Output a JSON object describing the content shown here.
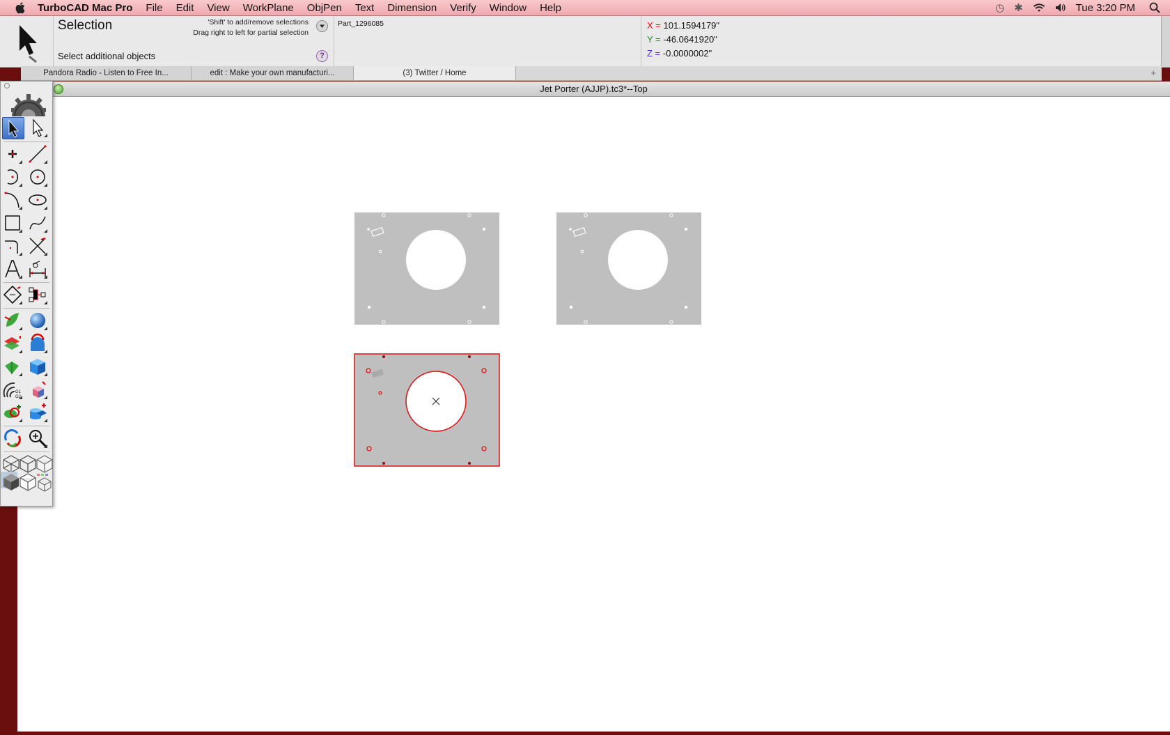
{
  "menubar": {
    "app_name": "TurboCAD Mac Pro",
    "items": [
      "File",
      "Edit",
      "View",
      "WorkPlane",
      "ObjPen",
      "Text",
      "Dimension",
      "Verify",
      "Window",
      "Help"
    ],
    "status_icons": [
      "time-machine-icon",
      "bluetooth-icon",
      "wifi-icon",
      "volume-icon"
    ],
    "clock": "Tue 3:20 PM"
  },
  "infobar": {
    "tool_name": "Selection",
    "hint_line1": "'Shift' to add/remove selections",
    "hint_line2": "Drag right to left for partial selection",
    "prompt": "Select additional objects",
    "help_label": "?",
    "part_name": "Part_1296085"
  },
  "coords": {
    "x_label": "X =",
    "x_value": "101.1594179\"",
    "y_label": "Y =",
    "y_value": "-46.0641920\"",
    "z_label": "Z =",
    "z_value": "-0.0000002\""
  },
  "browser_tabs": [
    {
      "label": "Pandora Radio - Listen to Free In..."
    },
    {
      "label": "edit : Make your own manufacturi..."
    },
    {
      "label": "(3) Twitter / Home"
    }
  ],
  "document": {
    "title": "Jet Porter (AJJP).tc3*--Top"
  },
  "colors": {
    "menubar": "#f3b8bc",
    "part_fill": "#bfbfbf",
    "selection": "#e01010",
    "desktop": "#6b0e0e"
  }
}
